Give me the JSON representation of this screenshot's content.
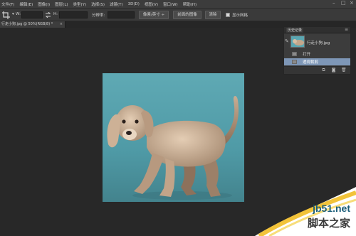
{
  "menu": [
    "文件(F)",
    "编辑(E)",
    "图像(I)",
    "图层(L)",
    "类型(Y)",
    "选择(S)",
    "滤镜(T)",
    "3D(D)",
    "视图(V)",
    "窗口(W)",
    "帮助(H)"
  ],
  "options": {
    "w_label": "W:",
    "h_label": "H:",
    "resolution_label": "分辨率:",
    "unit_select": "像素/英寸 ÷",
    "front_image_button": "前面的图像",
    "clear_button": "清除",
    "show_grid_label": "显示网格"
  },
  "document_tab": {
    "title": "行走小狗.jpg @ 50%(RGB/8) *",
    "close": "×"
  },
  "history_panel": {
    "title": "历史记录",
    "menu_icon": "≡",
    "snapshot_name": "行走小狗.jpg",
    "items": [
      "打开",
      "透视裁剪"
    ],
    "active_index": 1
  },
  "watermark": {
    "url": "jb51.net",
    "name": "脚本之家"
  },
  "colors": {
    "accent": "#7e97b7",
    "photo_background": "#5aa6b1"
  }
}
